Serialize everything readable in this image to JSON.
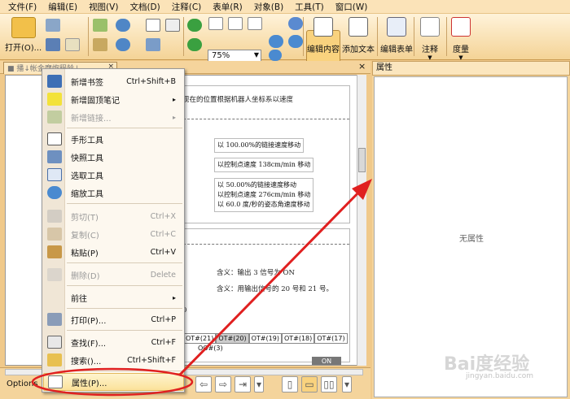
{
  "menubar": {
    "items": [
      "文件(F)",
      "编辑(E)",
      "视图(V)",
      "文档(D)",
      "注释(C)",
      "表单(R)",
      "对象(B)",
      "工具(T)",
      "窗口(W)"
    ]
  },
  "toolbar": {
    "open_label": "打开(O)...",
    "zoom_value": "75%",
    "edit_content_label": "编辑内容",
    "add_text_label": "添加文本",
    "edit_form_label": "编辑表单",
    "comment_label": "注释",
    "measure_label": "度量"
  },
  "document": {
    "tab_title": "■ 播↓帐金摩炮程龄↓",
    "line1": "现在的位置根据机器人坐标系以速度",
    "box1": "以 100.00%的链接速度移动",
    "box2": "以控制点速度 138cm/min 移动",
    "box3a": "以 50.00%的链接速度移动",
    "box3b": "以控制点速度 276cm/min 移动",
    "box3c": "以 60.0 度/秒的姿态角速度移动",
    "note1": "含义：输出 3 信号为 ON",
    "note2": "含义：用输出信号的 20 号和 21 号。",
    "ot_cells": [
      "OT#(21)",
      "OT#(20)",
      "OT#(19)",
      "OT#(18)",
      "OT#(17)"
    ],
    "oo": "OO#(3)",
    "on_button": "ON",
    "digit": "0"
  },
  "properties": {
    "title": "属性",
    "empty_text": "无属性"
  },
  "statusbar": {
    "options_label": "Options"
  },
  "context_menu": {
    "items": [
      {
        "label": "新增书签",
        "shortcut": "Ctrl+Shift+B"
      },
      {
        "label": "新增固顶笔记",
        "shortcut": "▸"
      },
      {
        "label": "新增链接...",
        "shortcut": "▸"
      },
      {
        "label": "手形工具",
        "shortcut": ""
      },
      {
        "label": "快照工具",
        "shortcut": ""
      },
      {
        "label": "选取工具",
        "shortcut": ""
      },
      {
        "label": "缩放工具",
        "shortcut": ""
      },
      {
        "label": "剪切(T)",
        "shortcut": "Ctrl+X"
      },
      {
        "label": "复制(C)",
        "shortcut": "Ctrl+C"
      },
      {
        "label": "粘贴(P)",
        "shortcut": "Ctrl+V"
      },
      {
        "label": "删除(D)",
        "shortcut": "Delete"
      },
      {
        "label": "前往",
        "shortcut": "▸"
      },
      {
        "label": "打印(P)...",
        "shortcut": "Ctrl+P"
      },
      {
        "label": "查找(F)...",
        "shortcut": "Ctrl+F"
      },
      {
        "label": "搜索()...",
        "shortcut": "Ctrl+Shift+F"
      },
      {
        "label": "属性(P)...",
        "shortcut": ""
      }
    ]
  },
  "watermark": {
    "brand": "Bai度经验",
    "url": "jingyan.baidu.com"
  },
  "colors": {
    "annotation_red": "#e02020",
    "toolbar_bg": "#f4d396",
    "menu_hover": "#fbe29a"
  }
}
